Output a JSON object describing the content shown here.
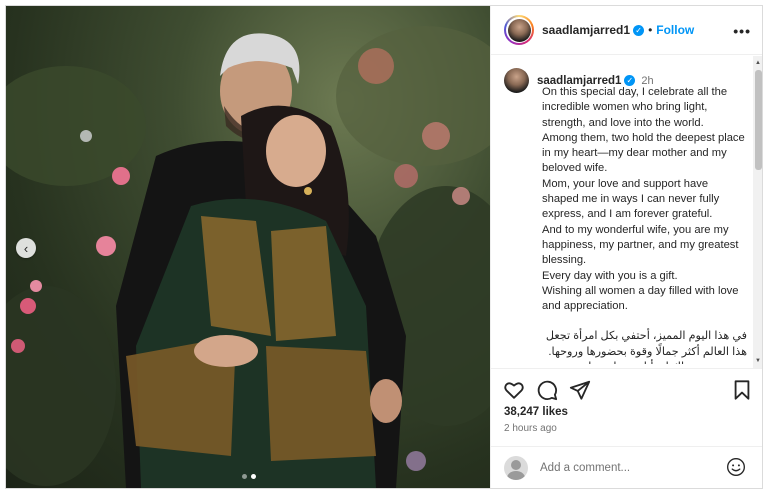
{
  "post": {
    "username": "saadlamjarred1",
    "follow_label": "Follow",
    "separator": "•",
    "more_label": "•••",
    "caption_time": "2h",
    "caption_lines": [
      "On this special day, I celebrate all the incredible women who bring light, strength, and love into the world.",
      "Among them, two hold the deepest place in my heart—my dear mother and my beloved wife.",
      "Mom, your love and support have shaped me in ways I can never fully express, and I am forever grateful.",
      "And to my wonderful wife, you are my happiness, my partner, and my greatest blessing.",
      "Every day with you is a gift.",
      "Wishing all women a day filled with love and appreciation."
    ],
    "caption_arabic": "في هذا اليوم المميز، أحتفي بكل امرأة تجعل هذا العالم أكثر جمالًا وقوة بحضورها وروحها. ومن بينهن، هناك امرأتان تنيران حياتي بحب لا حدود له: أمي الغالية وزوجتي العزيزة.",
    "likes": "38,247 likes",
    "posted_ago": "2 hours ago"
  },
  "comment": {
    "placeholder": "Add a comment..."
  },
  "carousel": {
    "current_index": 2,
    "total": 2
  },
  "icons": {
    "like": "heart-icon",
    "comment": "comment-icon",
    "share": "share-icon",
    "save": "bookmark-icon",
    "emoji": "emoji-icon",
    "verified": "verified-badge-icon"
  },
  "colors": {
    "accent": "#0095f6",
    "text": "#262626",
    "muted": "#737373"
  }
}
